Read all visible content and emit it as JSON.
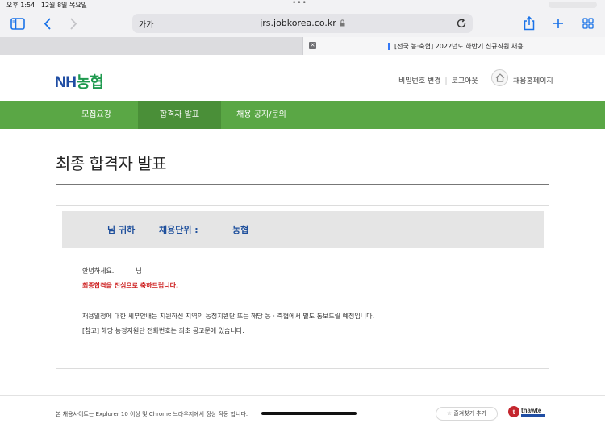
{
  "status": {
    "time": "오후 1:54",
    "date": "12월 8일 목요일",
    "dots": "•••"
  },
  "browser": {
    "reader_label": "가가",
    "url": "jrs.jobkorea.co.kr",
    "accent_color": "#1a73e8"
  },
  "tabs": {
    "active_title": "[전국 농·축협] 2022년도 하반기 신규직원 채용"
  },
  "header": {
    "logo_nh": "NH",
    "logo_kr": "농협",
    "links": [
      "비밀번호 변경",
      "로그아웃"
    ],
    "home_label": "채용홈페이지",
    "brand_blue": "#1f4da3",
    "brand_green": "#1f9a4f"
  },
  "nav": {
    "items": [
      "모집요강",
      "합격자 발표",
      "채용 공지/문의"
    ],
    "active_index": 1,
    "bar_color": "#5aa745"
  },
  "main": {
    "page_title": "최종 합격자 발표",
    "info": {
      "name_suffix": "님 귀하",
      "unit_label": "채용단위 :",
      "unit_value": "농협"
    },
    "message": {
      "greeting_prefix": "안녕하세요.",
      "greeting_suffix": "님",
      "congrats": "최종합격을 진심으로 축하드립니다.",
      "schedule": "채용일정에 대한 세부안내는 지원하신 지역의 농정지원단 또는 해당 농 · 축협에서 별도 통보드릴 예정입니다.",
      "reference": "[참고] 해당 농정지원단 전화번호는 최초 공고문에 있습니다."
    }
  },
  "footer": {
    "note": "본 채용사이트는 Explorer 10 이상 및 Chrome 브라우저에서 정상 작동 합니다.",
    "favorites_label": "즐겨찾기 추가",
    "seal_text": "thawte"
  }
}
